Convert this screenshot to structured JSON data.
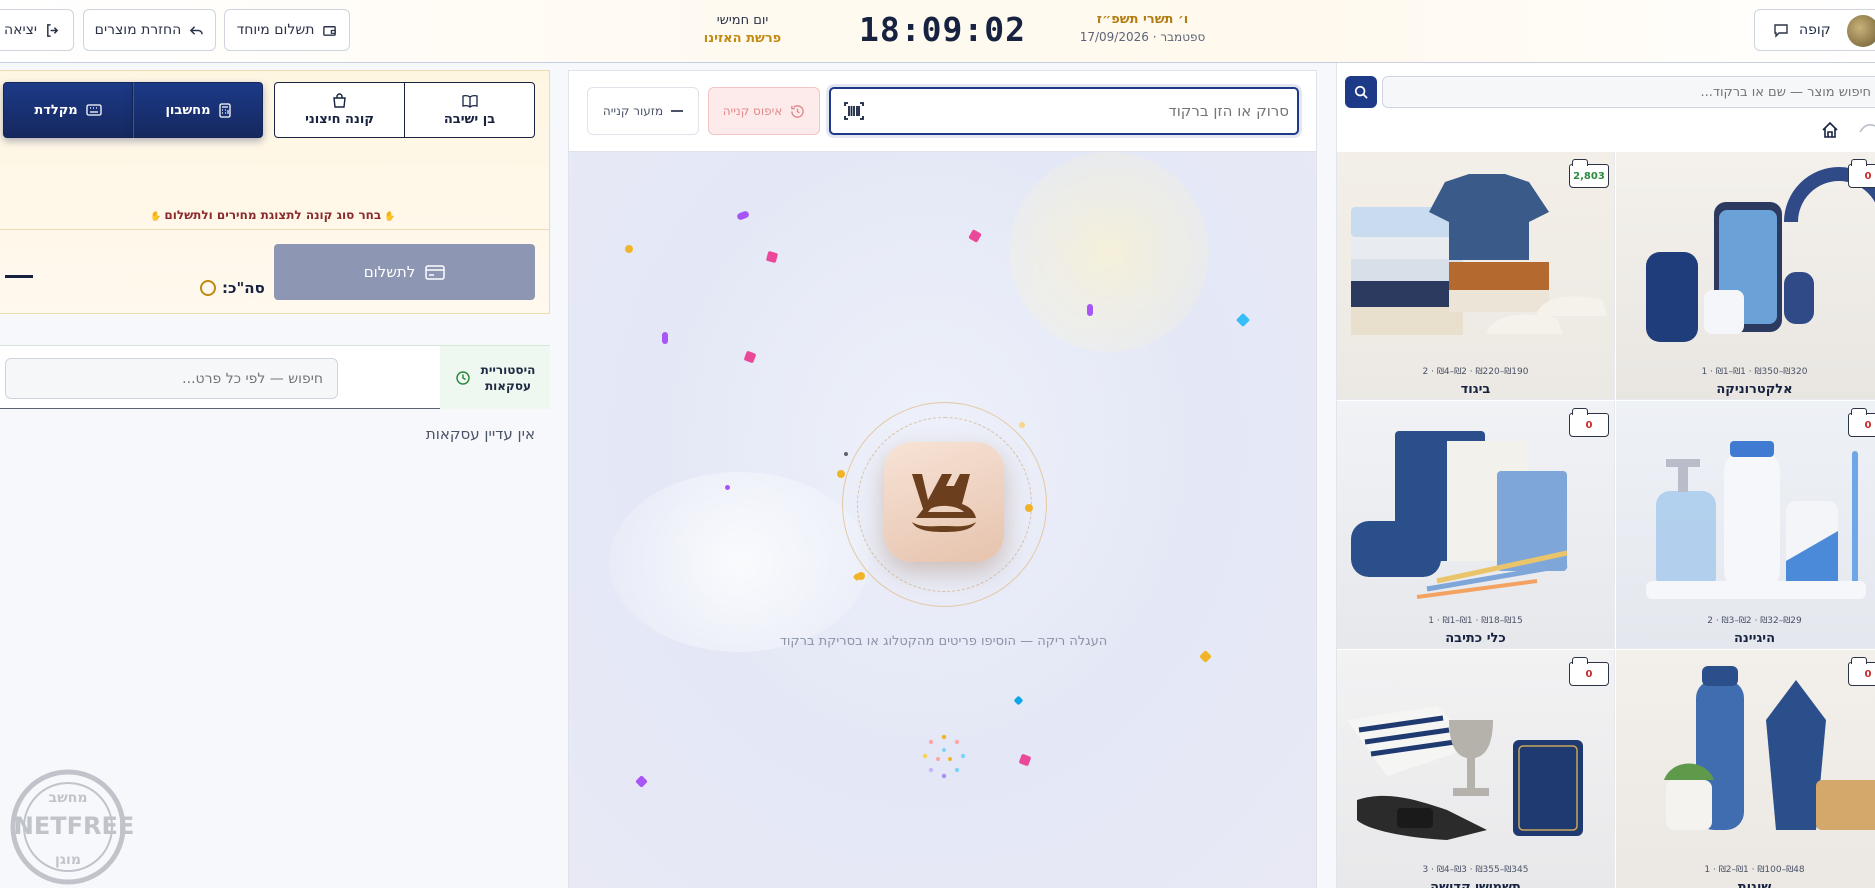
{
  "topbar": {
    "logout_label": "יציאה",
    "return_label": "החזרת מוצרים",
    "special_payment_label": "תשלום מיוחד",
    "weekday": "יום חמישי",
    "parasha": "פרשת האזינו",
    "clock": "18:09:02",
    "hebrew_date": "ו׳ תשרי תשפ״ז",
    "gregorian_date": "ספטמבר · 17/09/2026",
    "register_label": "קופה"
  },
  "cart": {
    "customer_types": [
      "בן ישיבה",
      "קונה חיצוני"
    ],
    "input_modes": [
      "מחשבון",
      "מקלדת"
    ],
    "hint": "בחר סוג קונה לתצוגת מחירים ולתשלום",
    "pay_label": "לתשלום",
    "total_label": "סה\"כ:"
  },
  "history": {
    "label_line1": "היסטוריית",
    "label_line2": "עסקאות",
    "search_placeholder": "חיפוש — לפי כל פרט...",
    "empty_text": "אין עדיין עסקאות"
  },
  "scan": {
    "placeholder": "סרוק או הזן ברקוד",
    "reset_label": "איפוס קנייה",
    "tendered_label": "מזעור קנייה",
    "empty_cart_text": "העגלה ריקה — הוסיפו פריטים מהקטלוג או בסריקת ברקוד"
  },
  "catalog": {
    "search_placeholder": "חיפוש מוצר — שם או ברקוד...",
    "tiles": [
      {
        "name": "אלקטרוניקה",
        "meta": "₪320–₪350 · ₪1–₪1 · 1",
        "count": "0",
        "count_color": "red"
      },
      {
        "name": "ביגוד",
        "meta": "₪190–₪220 · ₪2–₪4 · 2",
        "count": "2,803",
        "count_color": "green"
      },
      {
        "name": "היגיינה",
        "meta": "₪29–₪32 · ₪2–₪3 · 2",
        "count": "0",
        "count_color": "red"
      },
      {
        "name": "כלי כתיבה",
        "meta": "₪15–₪18 · ₪1–₪1 · 1",
        "count": "0",
        "count_color": "red"
      },
      {
        "name": "שונות",
        "meta": "₪48–₪100 · ₪1–₪2 · 1",
        "count": "0",
        "count_color": "red"
      },
      {
        "name": "תשמישי קדושה",
        "meta": "₪345–₪355 · ₪3–₪4 · 3",
        "count": "0",
        "count_color": "red"
      }
    ]
  },
  "stamp": {
    "line1": "מחשב",
    "line2": "NETFREE",
    "line3": "מוגן"
  },
  "colors": {
    "primary": "#1d3a88",
    "gold": "#c08a13",
    "danger": "#cc2a2a"
  }
}
